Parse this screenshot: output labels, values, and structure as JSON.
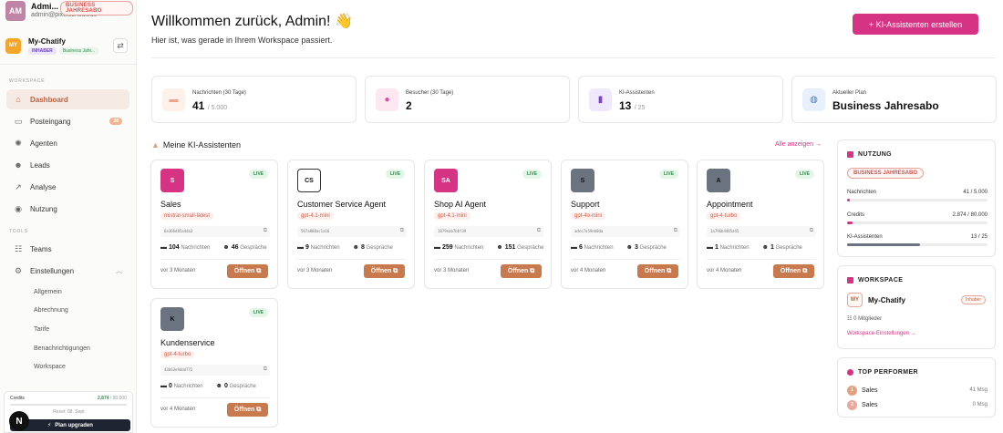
{
  "user": {
    "initials": "AM",
    "name": "Admi...",
    "email": "admin@pixelconsult.de",
    "plan_badge": "BUSINESS JAHRESABO"
  },
  "workspace": {
    "initials": "MY",
    "name": "My-Chatify",
    "role": "INHABER",
    "plan": "Business Jahr...",
    "swap_icon": "⇄"
  },
  "sidebar": {
    "section_main": "WORKSPACE",
    "items": [
      {
        "label": "Dashboard",
        "icon": "home-icon",
        "glyph": "⌂"
      },
      {
        "label": "Posteingang",
        "icon": "inbox-icon",
        "glyph": "▭",
        "count": "28"
      },
      {
        "label": "Agenten",
        "icon": "brain-icon",
        "glyph": "✺"
      },
      {
        "label": "Leads",
        "icon": "users-icon",
        "glyph": "☻"
      },
      {
        "label": "Analyse",
        "icon": "chart-icon",
        "glyph": "↗"
      },
      {
        "label": "Nutzung",
        "icon": "gauge-icon",
        "glyph": "◉"
      }
    ],
    "section_tools": "TOOLS",
    "tools": [
      {
        "label": "Teams",
        "icon": "team-icon",
        "glyph": "☷"
      },
      {
        "label": "Einstellungen",
        "icon": "gear-icon",
        "glyph": "⚙",
        "chevron": "︿"
      }
    ],
    "sub_items": [
      "Allgemein",
      "Abrechnung",
      "Tarife",
      "Benachrichtigungen",
      "Workspace"
    ]
  },
  "credits_box": {
    "label": "Credits",
    "used": "2.874",
    "total": "/ 80.000",
    "reset": "Reset: 08. Sept.",
    "upgrade": "Plan upgraden",
    "upgrade_icon": "⚡",
    "n_badge": "N"
  },
  "header": {
    "title": "Willkommen zurück, Admin! 👋",
    "subtitle": "Hier ist, was gerade in Ihrem Workspace passiert.",
    "create_button": "+  KI-Assistenten erstellen"
  },
  "stats": [
    {
      "label": "Nachrichten (30 Tage)",
      "value": "41",
      "suffix": "/ 5.000",
      "icon": "message-icon",
      "glyph": "▬",
      "color": "#f2a488",
      "bg": "#fdf1ea"
    },
    {
      "label": "Besucher (30 Tage)",
      "value": "2",
      "suffix": "",
      "icon": "location-icon",
      "glyph": "●",
      "color": "#e0479e",
      "bg": "#fde8f2"
    },
    {
      "label": "KI-Assistenten",
      "value": "13",
      "suffix": "/ 25",
      "icon": "bookmark-icon",
      "glyph": "▮",
      "color": "#7e3fd6",
      "bg": "#f0e8fb"
    },
    {
      "label": "Aktueller Plan",
      "value": "Business Jahresabo",
      "suffix": "",
      "icon": "globe-icon",
      "glyph": "◍",
      "color": "#4a78c8",
      "bg": "#e8f0fb"
    }
  ],
  "assistants_section": {
    "title": "Meine KI-Assistenten",
    "icon": "assistant-icon",
    "link": "Alle anzeigen →"
  },
  "assistant_labels": {
    "live": "LIVE",
    "messages": "Nachrichten",
    "chats": "Gespräche",
    "open": "Öffnen ⧉",
    "copy": "⧉",
    "msg_glyph": "▬",
    "chat_glyph": "☻"
  },
  "assistants": [
    {
      "initials": "S",
      "name": "Sales",
      "model": "mistral-small-latest",
      "id": "6e366d85a4da3",
      "messages": "104",
      "chats": "46",
      "date": "vor 3 Monaten",
      "bg": "#d63384",
      "fg": "#ffffff"
    },
    {
      "initials": "CS",
      "name": "Customer Service Agent",
      "model": "gpt-4.1-mini",
      "id": "567a888ac1a16",
      "messages": "9",
      "chats": "8",
      "date": "vor 3 Monaten",
      "bg": "#ffffff",
      "fg": "#111111"
    },
    {
      "initials": "SA",
      "name": "Shop AI Agent",
      "model": "gpt-4.1-mini",
      "id": "1879eab7bbf39",
      "messages": "259",
      "chats": "151",
      "date": "vor 3 Monaten",
      "bg": "#d63384",
      "fg": "#ffffff"
    },
    {
      "initials": "S",
      "name": "Support",
      "model": "gpt-4o-mini",
      "id": "adcc7e59eb0da",
      "messages": "6",
      "chats": "3",
      "date": "vor 4 Monaten",
      "bg": "#6b7280",
      "fg": "#111111"
    },
    {
      "initials": "A",
      "name": "Appointment",
      "model": "gpt-4-turbo",
      "id": "1a796b4485a45",
      "messages": "1",
      "chats": "1",
      "date": "vor 4 Monaten",
      "bg": "#6b7280",
      "fg": "#111111"
    },
    {
      "initials": "K",
      "name": "Kundenservice",
      "model": "gpt-4-turbo",
      "id": "43b63e9ddd772",
      "messages": "0",
      "chats": "0",
      "date": "vor 4 Monaten",
      "bg": "#6b7280",
      "fg": "#111111"
    }
  ],
  "usage": {
    "title": "NUTZUNG",
    "plan": "BUSINESS JAHRESABO",
    "rows": [
      {
        "label": "Nachrichten",
        "value": "41 / 5.000",
        "fraction": 0.008,
        "color": "#d63384"
      },
      {
        "label": "Credits",
        "value": "2.874 / 80.000",
        "fraction": 0.036,
        "color": "#d63384"
      },
      {
        "label": "KI-Assistenten",
        "value": "13 / 25",
        "fraction": 0.52,
        "color": "#6b7280"
      }
    ]
  },
  "ws_panel": {
    "title": "WORKSPACE",
    "initials": "MY",
    "name": "My-Chatify",
    "role": "Inhaber",
    "members": "0 Mitglieder",
    "members_glyph": "☷",
    "link": "Workspace-Einstellungen →"
  },
  "top_performer": {
    "title": "TOP PERFORMER",
    "rows": [
      {
        "rank": "1",
        "name": "Sales",
        "value": "41 Msg"
      },
      {
        "rank": "2",
        "name": "Sales",
        "value": "0 Msg"
      }
    ]
  }
}
